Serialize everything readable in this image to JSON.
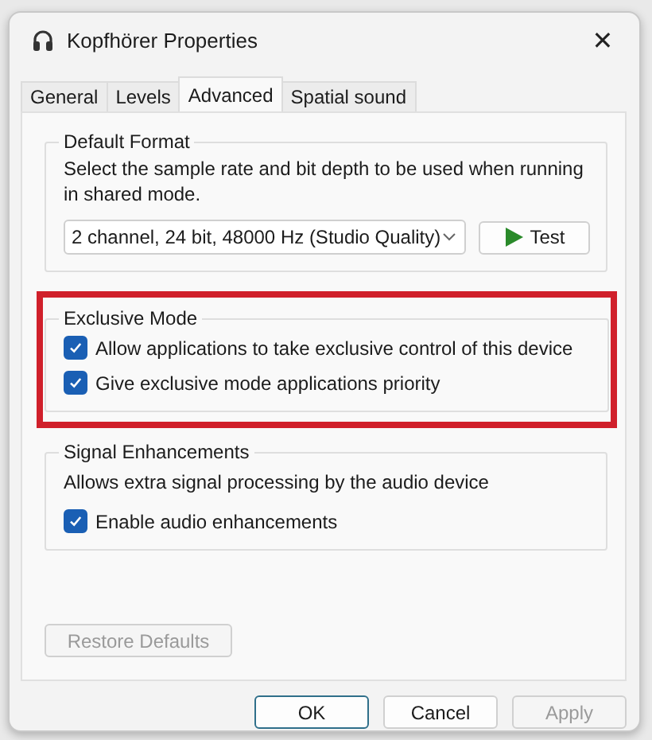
{
  "window": {
    "title": "Kopfhörer Properties",
    "close": "✕"
  },
  "tabs": [
    {
      "label": "General",
      "selected": false
    },
    {
      "label": "Levels",
      "selected": false
    },
    {
      "label": "Advanced",
      "selected": true
    },
    {
      "label": "Spatial sound",
      "selected": false
    }
  ],
  "default_format": {
    "title": "Default Format",
    "description": "Select the sample rate and bit depth to be used when running in shared mode.",
    "format": "2 channel, 24 bit, 48000 Hz (Studio Quality)",
    "test_button": "Test"
  },
  "exclusive_mode": {
    "title": "Exclusive Mode",
    "highlighted": true,
    "options": [
      {
        "label": "Allow applications to take exclusive control of this device",
        "checked": true
      },
      {
        "label": "Give exclusive mode applications priority",
        "checked": true
      }
    ]
  },
  "signal_enhancements": {
    "title": "Signal Enhancements",
    "description": "Allows extra signal processing by the audio device",
    "options": [
      {
        "label": "Enable audio enhancements",
        "checked": true
      }
    ]
  },
  "restore_button": {
    "label": "Restore Defaults",
    "disabled": true
  },
  "buttons": [
    {
      "label": "OK",
      "default": true,
      "disabled": false
    },
    {
      "label": "Cancel",
      "default": false,
      "disabled": false
    },
    {
      "label": "Apply",
      "default": false,
      "disabled": true
    }
  ]
}
